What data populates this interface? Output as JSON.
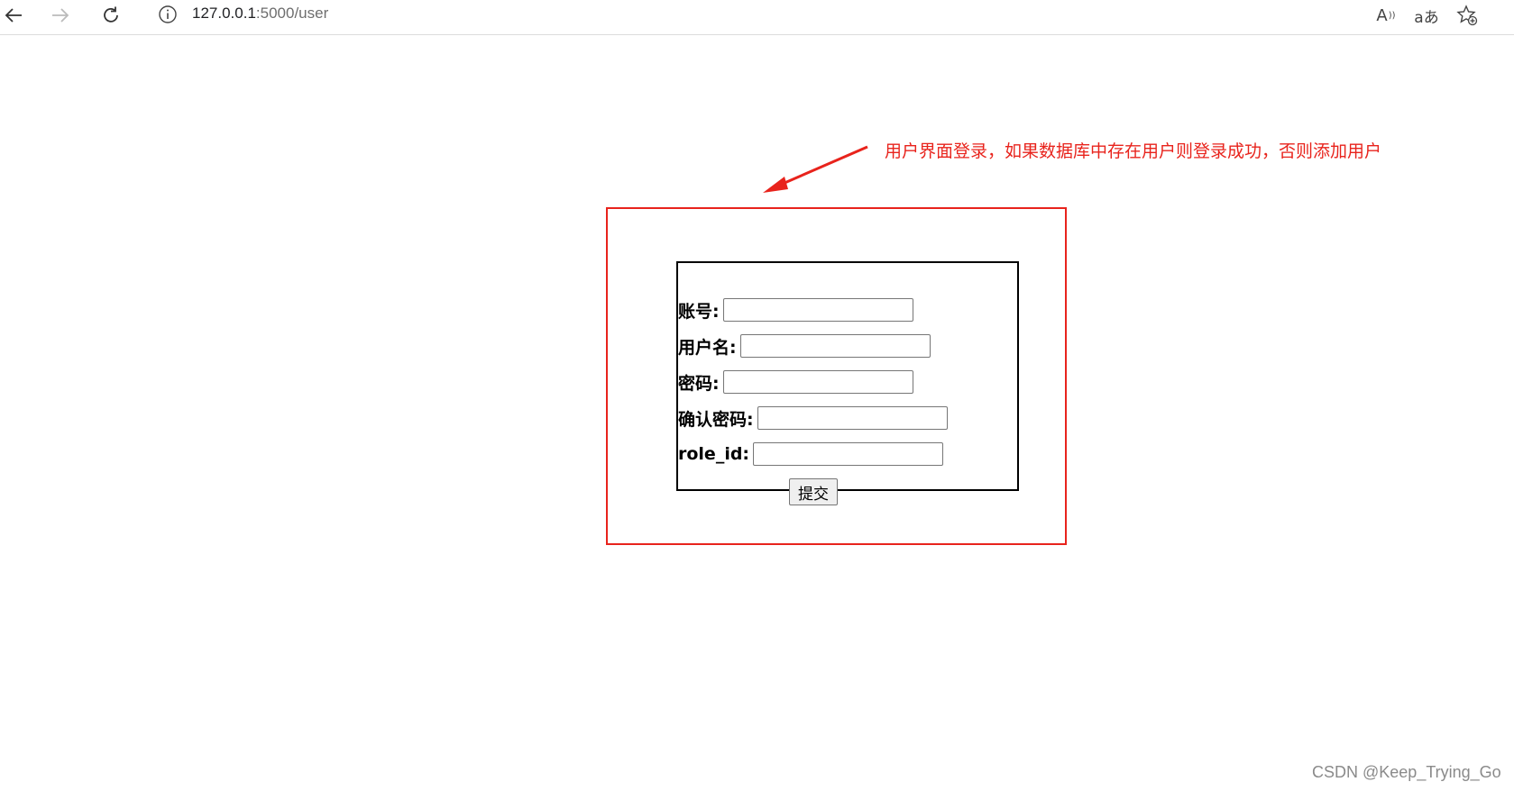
{
  "browser": {
    "url_host": "127.0.0.1",
    "url_path": ":5000/user",
    "icons": [
      "back-icon",
      "forward-icon",
      "reload-icon",
      "info-icon",
      "read-aloud-icon",
      "translate-icon",
      "favorite-add-icon"
    ],
    "read_aloud_glyph": "A",
    "translate_glyph": "aあ"
  },
  "annotation": {
    "text": "用户界面登录，如果数据库中存在用户则登录成功，否则添加用户",
    "color": "#e8231c"
  },
  "form": {
    "fields": [
      {
        "label": "账号:",
        "value": ""
      },
      {
        "label": "用户名:",
        "value": ""
      },
      {
        "label": "密码:",
        "value": ""
      },
      {
        "label": "确认密码:",
        "value": ""
      },
      {
        "label": "role_id:",
        "value": ""
      }
    ],
    "submit_label": "提交"
  },
  "watermark": "CSDN @Keep_Trying_Go"
}
